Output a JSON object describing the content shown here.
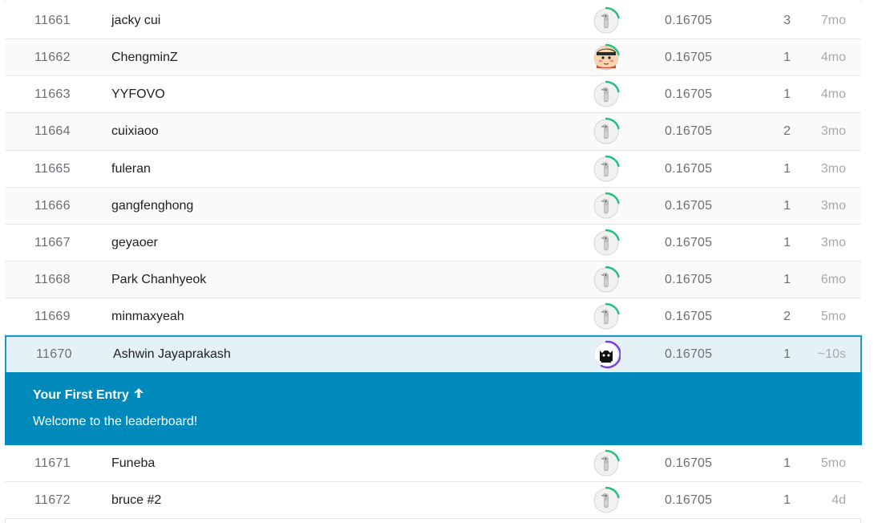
{
  "rows": [
    {
      "rank": "11661",
      "name": "jacky cui",
      "avatar": "default-goose-avatar",
      "score": "0.16705",
      "entries": "3",
      "last": "7mo"
    },
    {
      "rank": "11662",
      "name": "ChengminZ",
      "avatar": "cartoon-boy-avatar",
      "score": "0.16705",
      "entries": "1",
      "last": "4mo"
    },
    {
      "rank": "11663",
      "name": "YYFOVO",
      "avatar": "default-goose-avatar",
      "score": "0.16705",
      "entries": "1",
      "last": "4mo"
    },
    {
      "rank": "11664",
      "name": "cuixiaoo",
      "avatar": "default-goose-avatar",
      "score": "0.16705",
      "entries": "2",
      "last": "3mo"
    },
    {
      "rank": "11665",
      "name": "fuleran",
      "avatar": "default-goose-avatar",
      "score": "0.16705",
      "entries": "1",
      "last": "3mo"
    },
    {
      "rank": "11666",
      "name": "gangfenghong",
      "avatar": "default-goose-avatar",
      "score": "0.16705",
      "entries": "1",
      "last": "3mo"
    },
    {
      "rank": "11667",
      "name": "geyaoer",
      "avatar": "default-goose-avatar",
      "score": "0.16705",
      "entries": "1",
      "last": "3mo"
    },
    {
      "rank": "11668",
      "name": "Park Chanhyeok",
      "avatar": "default-goose-avatar",
      "score": "0.16705",
      "entries": "1",
      "last": "6mo"
    },
    {
      "rank": "11669",
      "name": "minmaxyeah",
      "avatar": "default-goose-avatar",
      "score": "0.16705",
      "entries": "2",
      "last": "5mo"
    }
  ],
  "current": {
    "rank": "11670",
    "name": "Ashwin Jayaprakash",
    "avatar": "black-cat-avatar",
    "score": "0.16705",
    "entries": "1",
    "last": "~10s"
  },
  "banner": {
    "title": "Your First Entry",
    "title_icon": "arrow-up-icon",
    "message": "Welcome to the leaderboard!"
  },
  "rows_after": [
    {
      "rank": "11671",
      "name": "Funeba",
      "avatar": "default-goose-avatar",
      "score": "0.16705",
      "entries": "1",
      "last": "5mo"
    },
    {
      "rank": "11672",
      "name": "bruce #2",
      "avatar": "default-goose-avatar",
      "score": "0.16705",
      "entries": "1",
      "last": "4d"
    }
  ],
  "colors": {
    "banner_bg": "#008abc",
    "highlight_row_bg": "#e4f2f8",
    "highlight_border": "#1f97c0",
    "novice_ring": "#20beff",
    "contributor_ring": "#20c080",
    "expert_ring": "#7c3aed"
  }
}
